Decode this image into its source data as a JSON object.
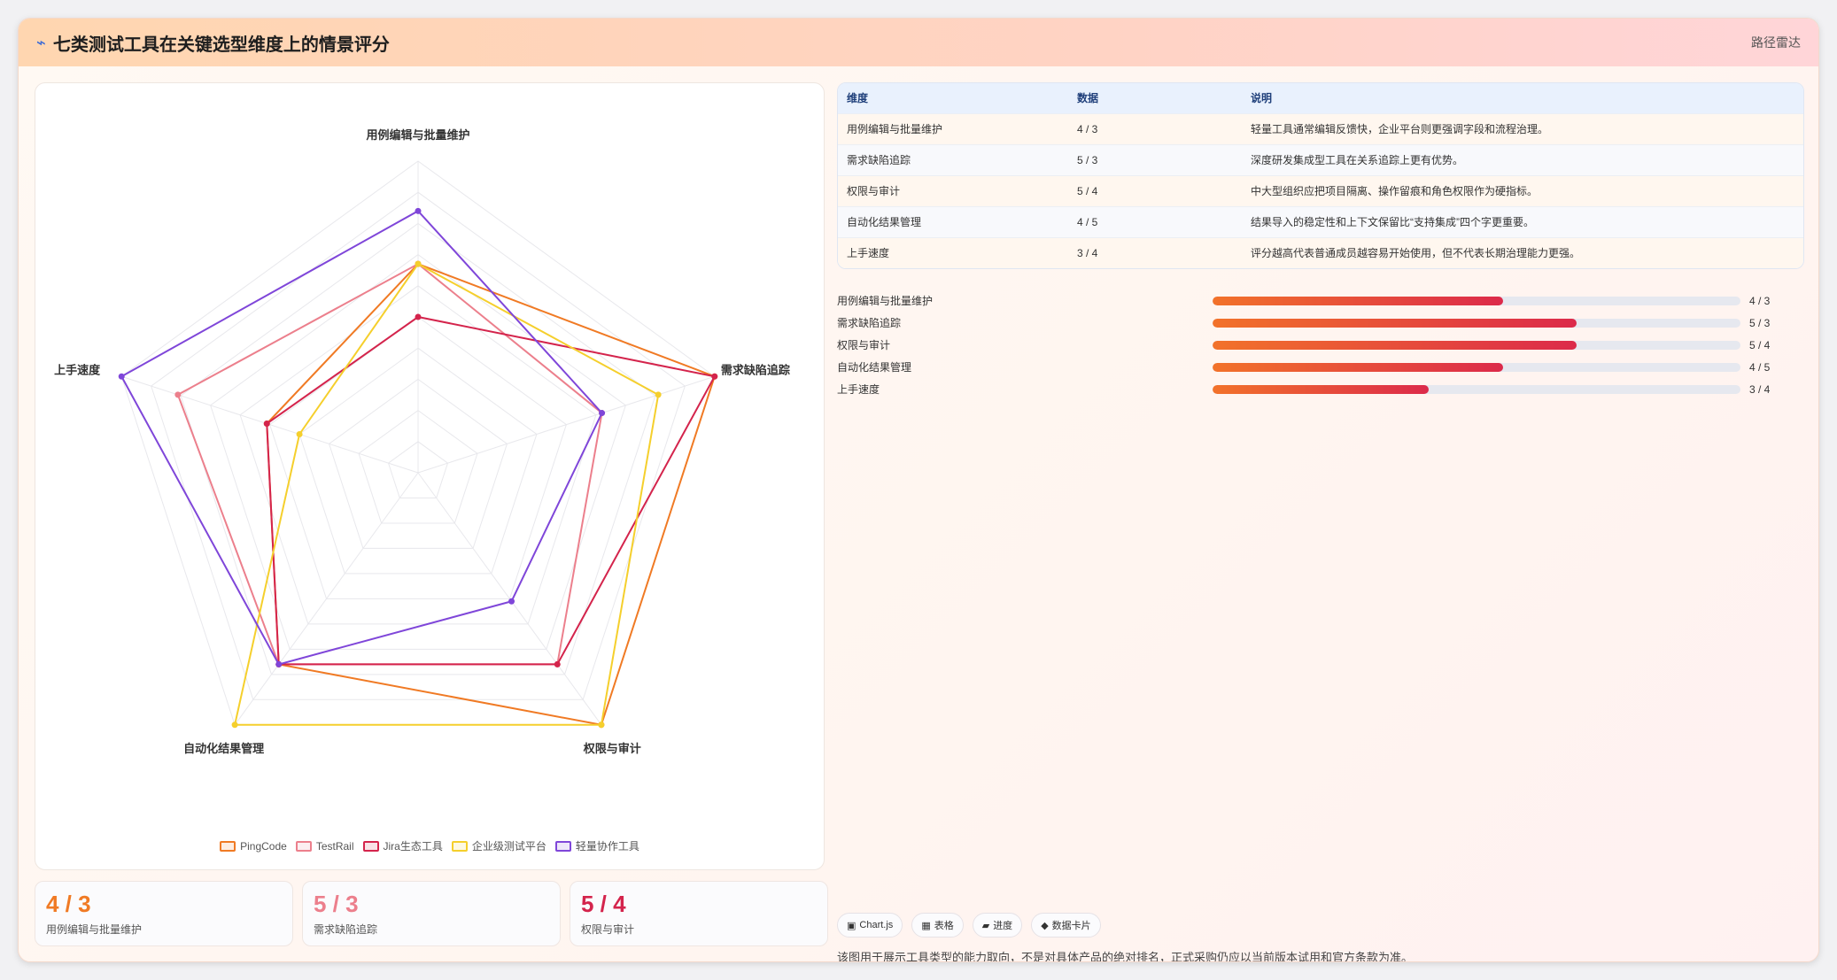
{
  "header": {
    "icon": "lightning-icon",
    "title": "七类测试工具在关键选型维度上的情景评分",
    "route_label": "路径雷达"
  },
  "chart_data": {
    "type": "radar",
    "axes": [
      "用例编辑与批量维护",
      "需求缺陷追踪",
      "权限与审计",
      "自动化结果管理",
      "上手速度"
    ],
    "range": [
      0,
      10
    ],
    "grid_levels": 10,
    "legend_position": "bottom",
    "series": [
      {
        "name": "PingCode",
        "color": "#f07a24",
        "values": [
          6.7,
          10,
          10,
          7.6,
          5.1
        ]
      },
      {
        "name": "TestRail",
        "color": "#ec7f8c",
        "values": [
          6.7,
          6.2,
          7.6,
          7.6,
          8.1
        ]
      },
      {
        "name": "Jira生态工具",
        "color": "#d4244c",
        "values": [
          5.0,
          10,
          7.6,
          7.6,
          5.1
        ]
      },
      {
        "name": "企业级测试平台",
        "color": "#f5cf2c",
        "values": [
          6.7,
          8.1,
          10,
          10,
          4.0
        ]
      },
      {
        "name": "轻量协作工具",
        "color": "#7f46d9",
        "values": [
          8.4,
          6.2,
          5.1,
          7.6,
          10
        ]
      }
    ]
  },
  "table": {
    "headers": [
      "维度",
      "数据",
      "说明"
    ],
    "rows": [
      [
        "用例编辑与批量维护",
        "4 / 3",
        "轻量工具通常编辑反馈快，企业平台则更强调字段和流程治理。"
      ],
      [
        "需求缺陷追踪",
        "5 / 3",
        "深度研发集成型工具在关系追踪上更有优势。"
      ],
      [
        "权限与审计",
        "5 / 4",
        "中大型组织应把项目隔离、操作留痕和角色权限作为硬指标。"
      ],
      [
        "自动化结果管理",
        "4 / 5",
        "结果导入的稳定性和上下文保留比“支持集成”四个字更重要。"
      ],
      [
        "上手速度",
        "3 / 4",
        "评分越高代表普通成员越容易开始使用，但不代表长期治理能力更强。"
      ]
    ]
  },
  "progress": [
    {
      "label": "用例编辑与批量维护",
      "value": "4 / 3",
      "fraction": 0.55
    },
    {
      "label": "需求缺陷追踪",
      "value": "5 / 3",
      "fraction": 0.69
    },
    {
      "label": "权限与审计",
      "value": "5 / 4",
      "fraction": 0.69
    },
    {
      "label": "自动化结果管理",
      "value": "4 / 5",
      "fraction": 0.55
    },
    {
      "label": "上手速度",
      "value": "3 / 4",
      "fraction": 0.41
    }
  ],
  "stats": [
    {
      "value": "4 / 3",
      "label": "用例编辑与批量维护",
      "color": "#f07a24"
    },
    {
      "value": "5 / 3",
      "label": "需求缺陷追踪",
      "color": "#ec7f8c"
    },
    {
      "value": "5 / 4",
      "label": "权限与审计",
      "color": "#d4244c"
    }
  ],
  "tags": [
    {
      "icon": "chart-icon",
      "glyph": "▣",
      "label": "Chart.js"
    },
    {
      "icon": "table-icon",
      "glyph": "▦",
      "label": "表格"
    },
    {
      "icon": "progress-icon",
      "glyph": "▰",
      "label": "进度"
    },
    {
      "icon": "card-icon",
      "glyph": "◆",
      "label": "数据卡片"
    }
  ],
  "note": "该图用于展示工具类型的能力取向，不是对具体产品的绝对排名，正式采购仍应以当前版本试用和官方条款为准。"
}
